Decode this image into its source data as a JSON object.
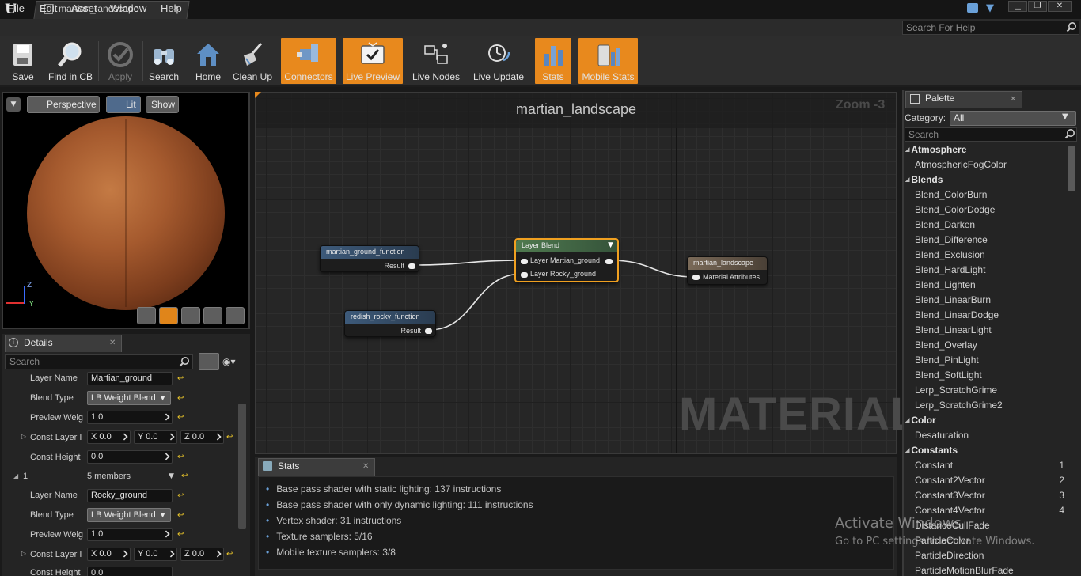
{
  "title_bar": {
    "doc_tab": "martian_landscape"
  },
  "menu": [
    "File",
    "Edit",
    "Asset",
    "Window",
    "Help"
  ],
  "help_search_placeholder": "Search For Help",
  "toolbar": [
    {
      "label": "Save",
      "icon": "save-icon",
      "active": false,
      "enabled": true
    },
    {
      "label": "Find in CB",
      "icon": "magnifier-icon",
      "active": false,
      "enabled": true
    },
    {
      "label": "Apply",
      "icon": "checkmark-icon",
      "active": false,
      "enabled": false
    },
    {
      "label": "Search",
      "icon": "binoculars-icon",
      "active": false,
      "enabled": true
    },
    {
      "label": "Home",
      "icon": "house-icon",
      "active": false,
      "enabled": true
    },
    {
      "label": "Clean Up",
      "icon": "broom-icon",
      "active": false,
      "enabled": true
    },
    {
      "label": "Connectors",
      "icon": "connectors-icon",
      "active": true,
      "enabled": true
    },
    {
      "label": "Live Preview",
      "icon": "tv-check-icon",
      "active": true,
      "enabled": true
    },
    {
      "label": "Live Nodes",
      "icon": "live-nodes-icon",
      "active": false,
      "enabled": true
    },
    {
      "label": "Live Update",
      "icon": "clock-refresh-icon",
      "active": false,
      "enabled": true
    },
    {
      "label": "Stats",
      "icon": "bar-stats-icon",
      "active": true,
      "enabled": true
    },
    {
      "label": "Mobile Stats",
      "icon": "mobile-stats-icon",
      "active": true,
      "enabled": true
    }
  ],
  "viewport": {
    "perspective": "Perspective",
    "lit": "Lit",
    "show": "Show",
    "axis_z": "Z",
    "axis_y": "Y"
  },
  "details": {
    "tab": "Details",
    "search_placeholder": "Search",
    "rows": [
      {
        "label": "Layer Name",
        "value": "Martian_ground",
        "kind": "text"
      },
      {
        "label": "Blend Type",
        "value": "LB Weight Blend",
        "kind": "combo"
      },
      {
        "label": "Preview Weig",
        "value": "1.0",
        "kind": "num"
      },
      {
        "label": "Const Layer I",
        "x": "X 0.0",
        "y": "Y 0.0",
        "z": "Z 0.0",
        "kind": "vec"
      },
      {
        "label": "Const Height",
        "value": "0.0",
        "kind": "num"
      },
      {
        "label": "1",
        "value": "5 members",
        "kind": "group"
      },
      {
        "label": "Layer Name",
        "value": "Rocky_ground",
        "kind": "text"
      },
      {
        "label": "Blend Type",
        "value": "LB Weight Blend",
        "kind": "combo"
      },
      {
        "label": "Preview Weig",
        "value": "1.0",
        "kind": "num"
      },
      {
        "label": "Const Layer I",
        "x": "X 0.0",
        "y": "Y 0.0",
        "z": "Z 0.0",
        "kind": "vec"
      },
      {
        "label": "Const Height",
        "value": "0.0",
        "kind": "num"
      }
    ]
  },
  "graph": {
    "title": "martian_landscape",
    "zoom": "Zoom -3",
    "watermark": "MATERIAL",
    "nodes": {
      "ground": {
        "title": "martian_ground_function",
        "pin": "Result"
      },
      "rocky": {
        "title": "redish_rocky_function",
        "pin": "Result"
      },
      "blend": {
        "title": "Layer Blend",
        "pin1": "Layer Martian_ground",
        "pin2": "Layer Rocky_ground"
      },
      "output": {
        "title": "martian_landscape",
        "pin": "Material Attributes"
      }
    }
  },
  "stats": {
    "tab": "Stats",
    "lines": [
      "Base pass shader with static lighting: 137 instructions",
      "Base pass shader with only dynamic lighting: 111 instructions",
      "Vertex shader: 31 instructions",
      "Texture samplers: 5/16",
      "Mobile texture samplers: 3/8"
    ]
  },
  "palette": {
    "tab": "Palette",
    "category_label": "Category:",
    "category_value": "All",
    "search_placeholder": "Search",
    "rows": [
      {
        "text": "Atmosphere",
        "type": "cat"
      },
      {
        "text": "AtmosphericFogColor",
        "type": "item"
      },
      {
        "text": "Blends",
        "type": "cat"
      },
      {
        "text": "Blend_ColorBurn",
        "type": "item"
      },
      {
        "text": "Blend_ColorDodge",
        "type": "item"
      },
      {
        "text": "Blend_Darken",
        "type": "item"
      },
      {
        "text": "Blend_Difference",
        "type": "item"
      },
      {
        "text": "Blend_Exclusion",
        "type": "item"
      },
      {
        "text": "Blend_HardLight",
        "type": "item"
      },
      {
        "text": "Blend_Lighten",
        "type": "item"
      },
      {
        "text": "Blend_LinearBurn",
        "type": "item"
      },
      {
        "text": "Blend_LinearDodge",
        "type": "item"
      },
      {
        "text": "Blend_LinearLight",
        "type": "item"
      },
      {
        "text": "Blend_Overlay",
        "type": "item"
      },
      {
        "text": "Blend_PinLight",
        "type": "item"
      },
      {
        "text": "Blend_SoftLight",
        "type": "item"
      },
      {
        "text": "Lerp_ScratchGrime",
        "type": "item"
      },
      {
        "text": "Lerp_ScratchGrime2",
        "type": "item"
      },
      {
        "text": "Color",
        "type": "cat"
      },
      {
        "text": "Desaturation",
        "type": "item"
      },
      {
        "text": "Constants",
        "type": "cat"
      },
      {
        "text": "Constant",
        "type": "item",
        "key": "1"
      },
      {
        "text": "Constant2Vector",
        "type": "item",
        "key": "2"
      },
      {
        "text": "Constant3Vector",
        "type": "item",
        "key": "3"
      },
      {
        "text": "Constant4Vector",
        "type": "item",
        "key": "4"
      },
      {
        "text": "DistanceCullFade",
        "type": "item"
      },
      {
        "text": "ParticleColor",
        "type": "item"
      },
      {
        "text": "ParticleDirection",
        "type": "item"
      },
      {
        "text": "ParticleMotionBlurFade",
        "type": "item"
      }
    ]
  },
  "activation": {
    "title": "Activate Windows",
    "subtitle": "Go to PC settings to activate Windows."
  },
  "colors": {
    "accent_orange": "#e8891d",
    "node_selected": "#f0a020",
    "pin_link": "#e6e6e6"
  }
}
